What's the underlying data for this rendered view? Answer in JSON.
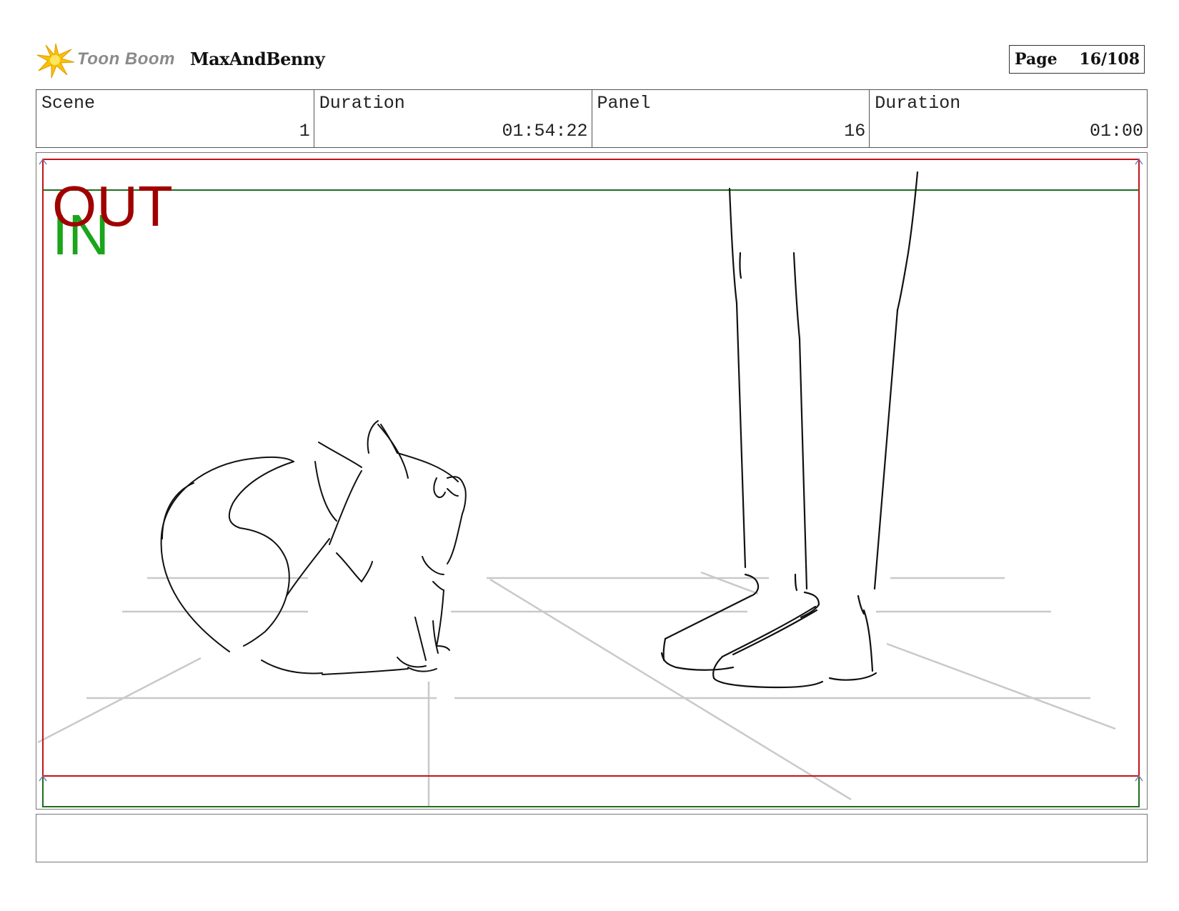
{
  "header": {
    "logo_text": "Toon Boom",
    "project": "MaxAndBenny",
    "page_label": "Page",
    "page_value": "16/108"
  },
  "info": {
    "scene_label": "Scene",
    "scene_value": "1",
    "scene_duration_label": "Duration",
    "scene_duration_value": "01:54:22",
    "panel_label": "Panel",
    "panel_value": "16",
    "panel_duration_label": "Duration",
    "panel_duration_value": "01:00"
  },
  "panel": {
    "out_label": "OUT",
    "in_label": "IN",
    "colors": {
      "out": "#a00000",
      "in": "#1aa51a",
      "frame_out": "#c4121a",
      "frame_in": "#1d6e1d",
      "guide": "#c8c8c8"
    }
  },
  "notes": {
    "text": ""
  }
}
